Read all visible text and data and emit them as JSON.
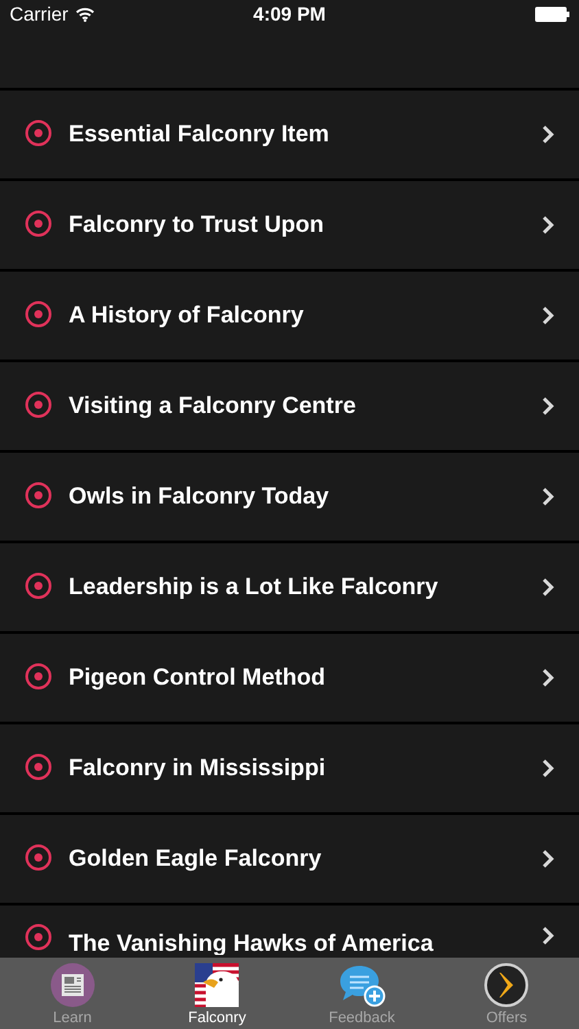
{
  "status_bar": {
    "carrier": "Carrier",
    "time": "4:09 PM"
  },
  "items": [
    {
      "title": "Essential Falconry Item"
    },
    {
      "title": "Falconry to Trust Upon"
    },
    {
      "title": "A History of Falconry"
    },
    {
      "title": "Visiting a Falconry Centre"
    },
    {
      "title": "Owls in Falconry Today"
    },
    {
      "title": "Leadership is a Lot Like Falconry"
    },
    {
      "title": "Pigeon Control Method"
    },
    {
      "title": "Falconry in Mississippi"
    },
    {
      "title": "Golden Eagle Falconry"
    },
    {
      "title": "The Vanishing Hawks of America"
    }
  ],
  "tabs": [
    {
      "label": "Learn",
      "kind": "news",
      "selected": false
    },
    {
      "label": "Falconry",
      "kind": "eagle",
      "selected": true
    },
    {
      "label": "Feedback",
      "kind": "chat",
      "selected": false
    },
    {
      "label": "Offers",
      "kind": "offers",
      "selected": false
    }
  ]
}
